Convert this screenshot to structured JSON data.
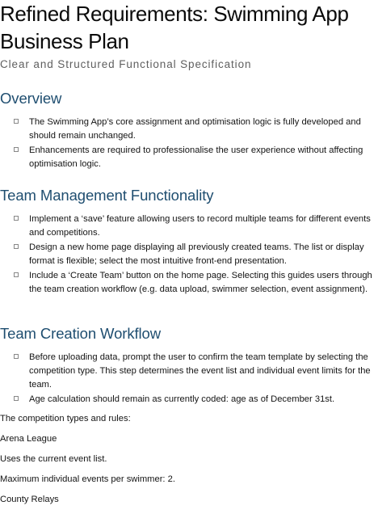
{
  "document": {
    "title": "Refined Requirements: Swimming App Business Plan",
    "subtitle": "Clear and Structured Functional Specification"
  },
  "sections": {
    "overview": {
      "heading": "Overview",
      "items": [
        "The Swimming App’s core assignment and optimisation logic is fully developed and should remain unchanged.",
        "Enhancements are required to professionalise the user experience without affecting optimisation logic."
      ]
    },
    "team_management": {
      "heading": "Team Management Functionality",
      "items": [
        "Implement a ‘save’ feature allowing users to record multiple teams for different events and competitions.",
        "Design a new home page displaying all previously created teams. The list or display format is flexible; select the most intuitive front-end presentation.",
        "Include a ‘Create Team’ button on the home page. Selecting this guides users through the team creation workflow (e.g. data upload, swimmer selection, event assignment)."
      ]
    },
    "team_creation": {
      "heading": "Team Creation Workflow",
      "items": [
        "Before uploading data, prompt the user to confirm the team template by selecting the competition type. This step determines the event list and individual event limits for the team.",
        "Age calculation should remain as currently coded: age as of December 31st."
      ]
    }
  },
  "paragraphs": {
    "competition_types_intro": "The competition types and rules:",
    "arena_league": "Arena League",
    "arena_event_list": "Uses the current event list.",
    "arena_max_events": "Maximum individual events per swimmer: 2.",
    "county_relays": "County Relays"
  }
}
